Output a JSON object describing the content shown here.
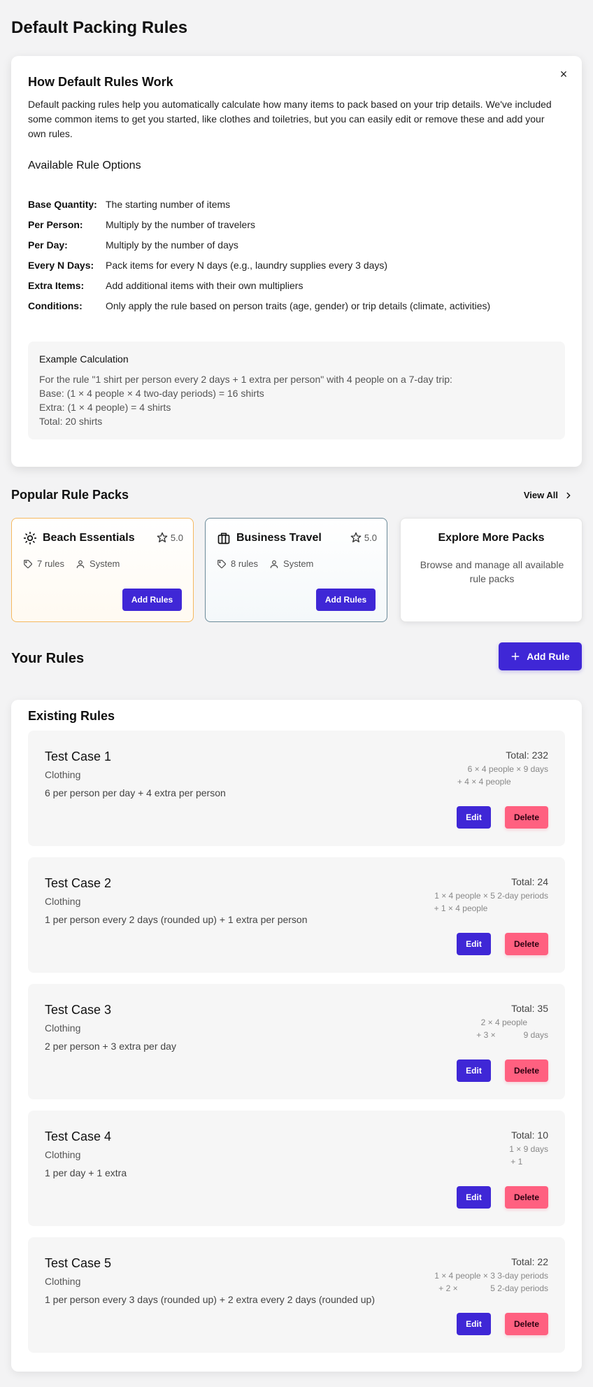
{
  "page": {
    "title": "Default Packing Rules"
  },
  "info": {
    "close_glyph": "×",
    "title": "How Default Rules Work",
    "description": "Default packing rules help you automatically calculate how many items to pack based on your trip details. We've included some common items to get you started, like clothes and toiletries, but you can easily edit or remove these and add your own rules.",
    "options_title": "Available Rule Options",
    "options": [
      {
        "key": "Base Quantity:",
        "value": "The starting number of items"
      },
      {
        "key": "Per Person:",
        "value": "Multiply by the number of travelers"
      },
      {
        "key": "Per Day:",
        "value": "Multiply by the number of days"
      },
      {
        "key": "Every N Days:",
        "value": "Pack items for every N days (e.g., laundry supplies every 3 days)"
      },
      {
        "key": "Extra Items:",
        "value": "Add additional items with their own multipliers"
      },
      {
        "key": "Conditions:",
        "value": "Only apply the rule based on person traits (age, gender) or trip details (climate, activities)"
      }
    ],
    "example": {
      "title": "Example Calculation",
      "lines": [
        "For the rule \"1 shirt per person every 2 days + 1 extra per person\" with 4 people on a 7-day trip:",
        "Base: (1 × 4 people × 4 two-day periods) = 16 shirts",
        "Extra: (1 × 4 people) = 4 shirts",
        "Total: 20 shirts"
      ]
    }
  },
  "packs": {
    "title": "Popular Rule Packs",
    "view_all": "View All",
    "items": [
      {
        "name": "Beach Essentials",
        "icon": "sun-icon",
        "rating": "5.0",
        "rules": "7 rules",
        "author": "System",
        "button": "Add Rules",
        "accent": "#f5b960"
      },
      {
        "name": "Business Travel",
        "icon": "briefcase-icon",
        "rating": "5.0",
        "rules": "8 rules",
        "author": "System",
        "button": "Add Rules",
        "accent": "#6b8a99"
      }
    ],
    "explore": {
      "title": "Explore More Packs",
      "text": "Browse and manage all available rule packs"
    }
  },
  "your_rules": {
    "title": "Your Rules",
    "add_button": "Add Rule",
    "existing_title": "Existing Rules",
    "rules": [
      {
        "name": "Test Case 1",
        "category": "Clothing",
        "description": "6 per person per day + 4 extra per person",
        "total": "Total: 232",
        "breakdown": [
          "6 × 4 people × 9 days",
          "+ 4 × 4 people                "
        ],
        "edit": "Edit",
        "delete": "Delete"
      },
      {
        "name": "Test Case 2",
        "category": "Clothing",
        "description": "1 per person every 2 days (rounded up) + 1 extra per person",
        "total": "Total: 24",
        "breakdown": [
          "1 × 4 people × 5 2-day periods",
          "+ 1 × 4 people                          "
        ],
        "edit": "Edit",
        "delete": "Delete"
      },
      {
        "name": "Test Case 3",
        "category": "Clothing",
        "description": "2 per person + 3 extra per day",
        "total": "Total: 35",
        "breakdown": [
          "2 × 4 people         ",
          "+ 3 ×            9 days"
        ],
        "edit": "Edit",
        "delete": "Delete"
      },
      {
        "name": "Test Case 4",
        "category": "Clothing",
        "description": "1 per day + 1 extra",
        "total": "Total: 10",
        "breakdown": [
          "1 × 9 days",
          "+ 1           "
        ],
        "edit": "Edit",
        "delete": "Delete"
      },
      {
        "name": "Test Case 5",
        "category": "Clothing",
        "description": "1 per person every 3 days (rounded up) + 2 extra every 2 days (rounded up)",
        "total": "Total: 22",
        "breakdown": [
          "1 × 4 people × 3 3-day periods",
          "+ 2 ×              5 2-day periods"
        ],
        "edit": "Edit",
        "delete": "Delete"
      }
    ]
  },
  "colors": {
    "primary": "#3f27d6",
    "danger": "#ff6080",
    "beach_border": "#f5b960",
    "business_border": "#6b8a99"
  }
}
